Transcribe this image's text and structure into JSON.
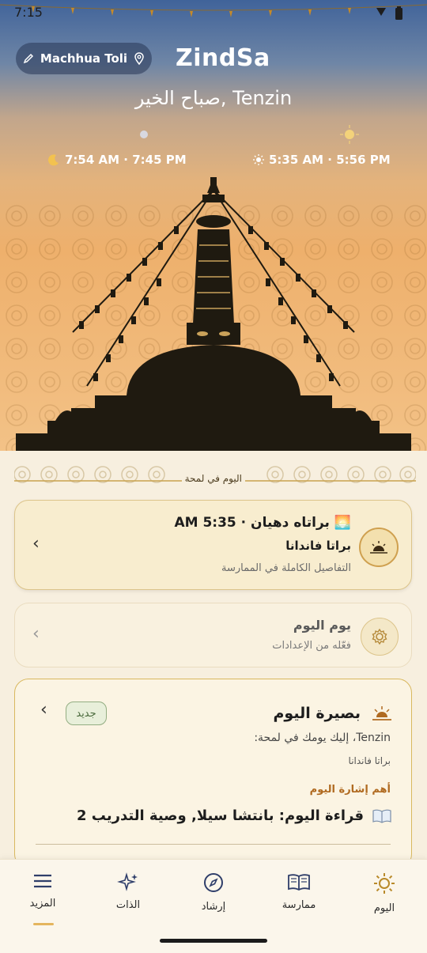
{
  "status": {
    "time": "7:15"
  },
  "header": {
    "location": "Machhua Toli",
    "brand": "ZindSa",
    "greeting": "صباح الخير, Tenzin",
    "moon_times": "7:54 AM · 7:45 PM",
    "sun_times": "5:35 AM · 5:56 PM",
    "icons": [
      "pencil-icon",
      "location-pin-icon",
      "moon-icon",
      "sun-icon"
    ]
  },
  "glance": {
    "label": "اليوم في لمحة"
  },
  "card_practice": {
    "title": "🌅 براتاه دهيان · 5:35 AM",
    "subtitle": "براتا فاندانا",
    "detail": "التفاصيل الكاملة في الممارسة",
    "icon": "sunrise-icon"
  },
  "card_day": {
    "title": "يوم اليوم",
    "detail": "فعّله من الإعدادات",
    "icon": "gear-icon"
  },
  "card_insight": {
    "badge": "جديد",
    "title": "بصيرة اليوم",
    "intro": "Tenzin، إليك يومك في لمحة:",
    "item": "براتا فاندانا",
    "highlight_label": "أهم إشارة اليوم",
    "reading": "قراءة اليوم: بانتشا سيلا, وصية التدريب 2",
    "icon": "sunrise-icon"
  },
  "tabs": [
    {
      "label": "اليوم",
      "icon": "sun-icon"
    },
    {
      "label": "ممارسة",
      "icon": "book-icon"
    },
    {
      "label": "إرشاد",
      "icon": "compass-icon"
    },
    {
      "label": "الذات",
      "icon": "sparkles-icon"
    },
    {
      "label": "المزيد",
      "icon": "menu-icon"
    }
  ],
  "colors": {
    "accent": "#e4b55d",
    "card_border": "#dcc48a",
    "badge_green": "#4a6a3c"
  }
}
